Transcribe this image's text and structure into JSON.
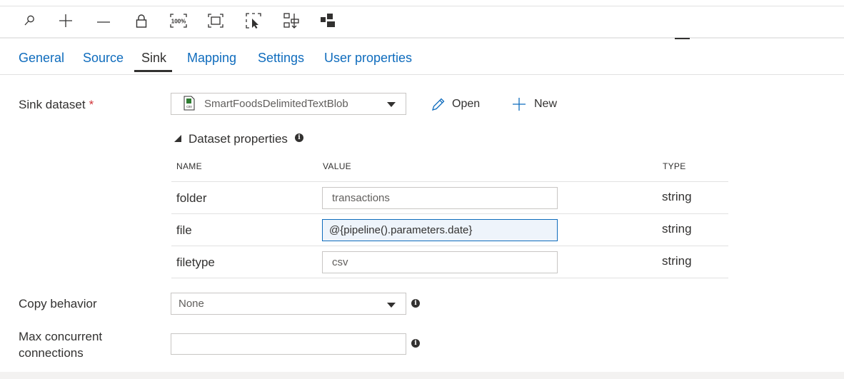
{
  "toolbar": {
    "icons": [
      "search-icon",
      "zoom-in-icon",
      "zoom-out-icon",
      "lock-icon",
      "zoom-100-icon",
      "fit-to-screen-icon",
      "select-icon",
      "auto-align-icon",
      "toggle-panel-icon"
    ],
    "zoom_100_label": "100%"
  },
  "tabs": [
    {
      "label": "General",
      "active": false
    },
    {
      "label": "Source",
      "active": false
    },
    {
      "label": "Sink",
      "active": true
    },
    {
      "label": "Mapping",
      "active": false
    },
    {
      "label": "Settings",
      "active": false
    },
    {
      "label": "User properties",
      "active": false
    }
  ],
  "sink_dataset": {
    "label": "Sink dataset",
    "required_mark": "*",
    "selected": "SmartFoodsDelimitedTextBlob",
    "file_icon_text": "csv",
    "open_label": "Open",
    "new_label": "New"
  },
  "dataset_properties": {
    "title": "Dataset properties",
    "columns": {
      "name": "NAME",
      "value": "VALUE",
      "type": "TYPE"
    },
    "rows": [
      {
        "name": "folder",
        "value": "transactions",
        "type": "string"
      },
      {
        "name": "file",
        "value": "@{pipeline().parameters.date}",
        "type": "string"
      },
      {
        "name": "filetype",
        "value": "csv",
        "type": "string"
      }
    ]
  },
  "copy_behavior": {
    "label": "Copy behavior",
    "selected": "None"
  },
  "max_concurrent": {
    "label_line1": "Max concurrent",
    "label_line2": "connections",
    "value": ""
  },
  "colors": {
    "accent": "#0f6cbd",
    "required": "#d13438",
    "text": "#323130"
  }
}
